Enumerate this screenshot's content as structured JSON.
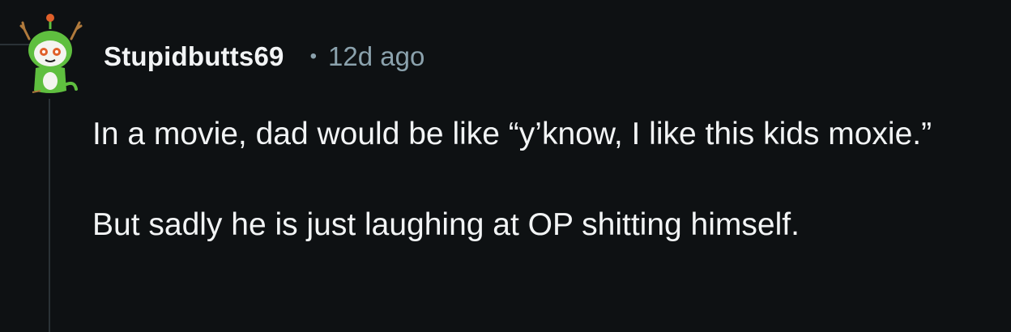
{
  "comment": {
    "author": "Stupidbutts69",
    "separator": "•",
    "age": "12d ago",
    "avatar_icon": "snoo-deer-avatar-icon",
    "paragraphs": [
      "In a movie, dad would be like “y’know, I like this kids moxie.”",
      "But sadly he is just laughing at OP shitting himself."
    ]
  },
  "colors": {
    "background": "#0e1113",
    "text": "#f2f4f5",
    "muted": "#8ba2ad",
    "thread_line": "#2a3236",
    "avatar_green": "#5fbf3f"
  }
}
